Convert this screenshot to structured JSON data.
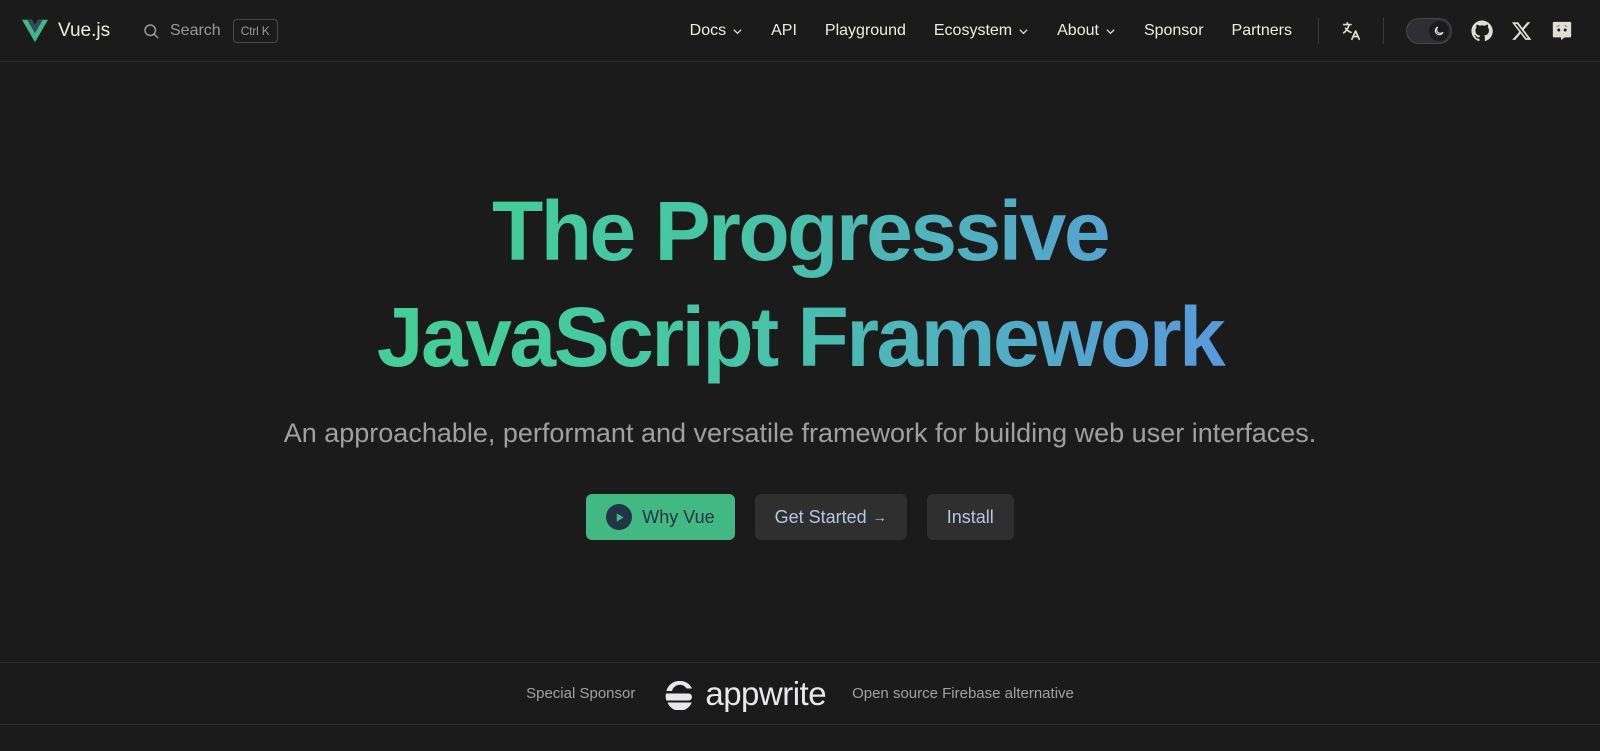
{
  "nav": {
    "brand": "Vue.js",
    "search_label": "Search",
    "search_shortcut": "Ctrl K",
    "links": [
      {
        "label": "Docs",
        "has_dropdown": true
      },
      {
        "label": "API",
        "has_dropdown": false
      },
      {
        "label": "Playground",
        "has_dropdown": false
      },
      {
        "label": "Ecosystem",
        "has_dropdown": true
      },
      {
        "label": "About",
        "has_dropdown": true
      },
      {
        "label": "Sponsor",
        "has_dropdown": false
      },
      {
        "label": "Partners",
        "has_dropdown": false
      }
    ],
    "icons": [
      "translate-icon",
      "theme-toggle",
      "github-icon",
      "x-icon",
      "discord-icon"
    ]
  },
  "hero": {
    "tagline_line1": "The Progressive",
    "tagline_line2": "JavaScript Framework",
    "description": "An approachable, performant and versatile framework for building web user interfaces.",
    "buttons": {
      "why_vue": "Why Vue",
      "get_started": "Get Started",
      "install": "Install"
    }
  },
  "sponsor": {
    "label": "Special Sponsor",
    "name": "appwrite",
    "tagline": "Open source Firebase alternative"
  },
  "colors": {
    "brand_green": "#42b883",
    "gradient_start": "#42d392",
    "gradient_end": "#647eff",
    "background": "#1b1b1b"
  }
}
